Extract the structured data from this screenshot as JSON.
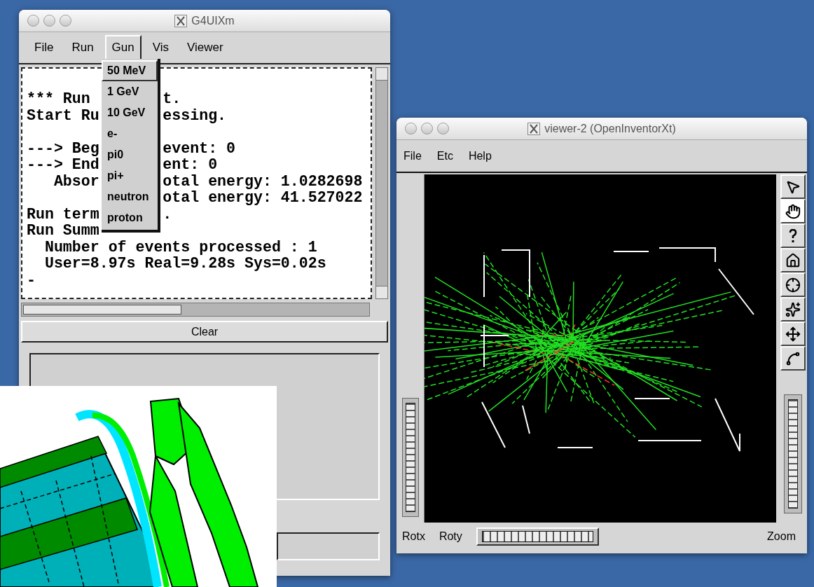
{
  "console_window": {
    "title": "G4UIXm",
    "menu": [
      {
        "label": "File",
        "selected": false
      },
      {
        "label": "Run",
        "selected": false
      },
      {
        "label": "Gun",
        "selected": true
      },
      {
        "label": "Vis",
        "selected": false
      },
      {
        "label": "Viewer",
        "selected": false
      }
    ],
    "gun_menu": [
      {
        "label": "50 MeV",
        "selected": true
      },
      {
        "label": "1 GeV",
        "selected": false
      },
      {
        "label": "10 GeV",
        "selected": false
      },
      {
        "label": "e-",
        "selected": false
      },
      {
        "label": "pi0",
        "selected": false
      },
      {
        "label": "pi+",
        "selected": false
      },
      {
        "label": "neutron",
        "selected": false
      },
      {
        "label": "proton",
        "selected": false
      }
    ],
    "output_lines": [
      {
        "kind": "text",
        "left": "*** Run",
        "right": "t."
      },
      {
        "kind": "text",
        "left": "Start Ru",
        "right": "essing."
      },
      {
        "kind": "blank"
      },
      {
        "kind": "text",
        "left": "---> Beg",
        "right": "event: 0"
      },
      {
        "kind": "text",
        "left": "---> End",
        "right": "ent: 0"
      },
      {
        "kind": "text",
        "left": "   Absor",
        "right": "otal energy: 1.0282698"
      },
      {
        "kind": "text",
        "right": "otal energy: 41.527022"
      },
      {
        "kind": "text",
        "left": "Run term",
        "right": "."
      },
      {
        "kind": "text",
        "left": "Run Summ"
      },
      {
        "kind": "text",
        "left": "  Number of events processed : 1"
      },
      {
        "kind": "text",
        "left": "  User=8.97s Real=9.28s Sys=0.02s"
      },
      {
        "kind": "text",
        "left": "-"
      }
    ],
    "clear_button": "Clear"
  },
  "viewer_window": {
    "title": "viewer-2 (OpenInventorXt)",
    "menu": [
      "File",
      "Etc",
      "Help"
    ],
    "wheel_labels": [
      "Rotx",
      "Roty"
    ],
    "zoom_label": "Zoom"
  }
}
